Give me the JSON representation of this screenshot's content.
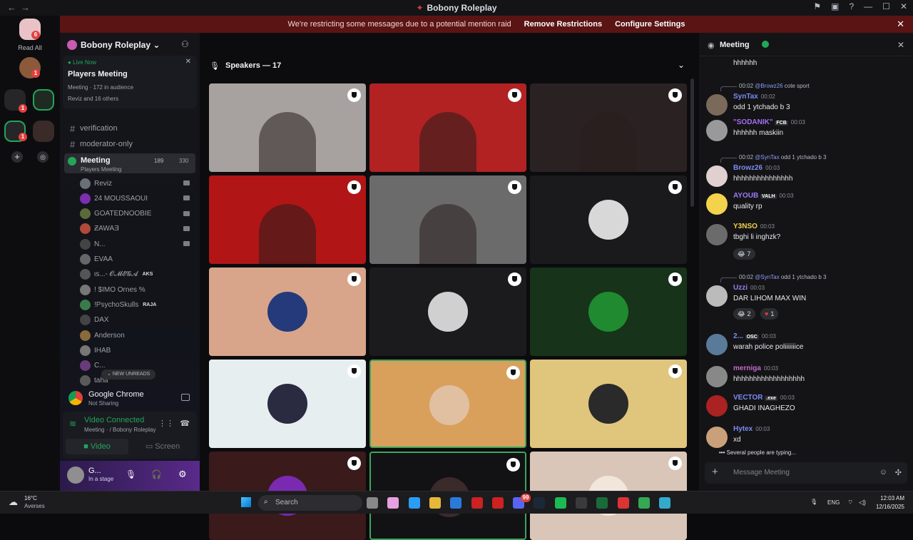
{
  "window": {
    "title": "Bobony Roleplay"
  },
  "banner": {
    "message": "We're restricting some messages due to a potential mention raid",
    "remove": "Remove Restrictions",
    "configure": "Configure Settings"
  },
  "rail": {
    "read_all": "Read All",
    "badges": [
      "6",
      "1",
      "1",
      "1",
      "1"
    ]
  },
  "sidebar": {
    "server_name": "Bobony Roleplay",
    "live": {
      "label": "Live Now",
      "title": "Players Meeting",
      "meta_channel": "Meeting",
      "audience": "172 in audience",
      "others": "Reviz and 16 others"
    },
    "channels": [
      {
        "name": "verification"
      },
      {
        "name": "moderator-only"
      }
    ],
    "active_channel": {
      "name": "Meeting",
      "sub": "Players Meeting",
      "count_a": "189",
      "count_b": "330"
    },
    "users": [
      {
        "name": "Reviz",
        "tag": ""
      },
      {
        "name": "24 MOUSSAOUI",
        "tag": ""
      },
      {
        "name": "GOATEDNOOBIE",
        "tag": ""
      },
      {
        "name": "ƵAWAƎ",
        "tag": ""
      },
      {
        "name": "N...",
        "tag": ""
      },
      {
        "name": "EVAA",
        "tag": ""
      },
      {
        "name": "ιѕ...- 𝓞𝓜𝓔𝓖𝓐",
        "tag": "AKS"
      },
      {
        "name": "! $IMO Ornes %",
        "tag": ""
      },
      {
        "name": "!PsychoSkulls",
        "tag": "RAJA"
      },
      {
        "name": "DAX",
        "tag": ""
      },
      {
        "name": "Anderson",
        "tag": ""
      },
      {
        "name": "IHAB",
        "tag": ""
      },
      {
        "name": "C...",
        "tag": ""
      },
      {
        "name": "taha",
        "tag": ""
      }
    ],
    "new_unreads": "NEW UNREADS",
    "activity": {
      "app": "Google Chrome",
      "status": "Not Sharing"
    },
    "voice": {
      "status": "Video Connected",
      "detail": "Meeting",
      "server": "/ Bobony Roleplay",
      "video_btn": "Video",
      "screen_btn": "Screen"
    },
    "account": {
      "name": "G...",
      "status": "In a stage"
    }
  },
  "stage": {
    "header": "Speakers — 17"
  },
  "chat": {
    "title": "Meeting",
    "messages": [
      {
        "name": "",
        "time": "",
        "text": "hhhhhh",
        "color": "#e8e9eb"
      },
      {
        "reply_time": "00:02",
        "reply_user": "@Browz26",
        "reply_text": "cote sport",
        "name": "SynTax",
        "time": "00:02",
        "text": "odd 1 ytchado b 3",
        "color": "#7b8cf0"
      },
      {
        "name": "\"SODANIK\"",
        "tag": "FCB",
        "time": "00:03",
        "text": "hhhhhh maskiin",
        "color": "#a66cf5"
      },
      {
        "reply_time": "00:02",
        "reply_user": "@SynTax",
        "reply_text": "odd 1 ytchado b 3",
        "name": "Browz26",
        "time": "00:03",
        "text": "hhhhhhhhhhhhhhh",
        "color": "#7b8cf0"
      },
      {
        "name": "AYOUB",
        "tag": "VALH",
        "time": "00:03",
        "text": "quality rp",
        "color": "#9a7cf2"
      },
      {
        "name": "Y3NSO",
        "time": "00:03",
        "text": "tbghi li inghzk?",
        "color": "#f2d34b"
      },
      {
        "reply_time": "00:02",
        "reply_user": "@SynTax",
        "reply_text": "odd 1 ytchado b 3",
        "name": "Uzzi",
        "time": "00:03",
        "text": "DAR LIHOM MAX WIN",
        "color": "#9a7cf2"
      },
      {
        "name": "2...",
        "tag": "OSC",
        "time": "00:03",
        "text": "warah police poliiiiiiice",
        "color": "#7b8cf0"
      },
      {
        "name": "merniga",
        "time": "00:03",
        "text": "hhhhhhhhhhhhhhhhhh",
        "color": "#c46ac9"
      },
      {
        "name": "VECTOR",
        "tag": ".exe",
        "time": "00:03",
        "text": "GHADI INAGHEZO",
        "color": "#7b8cf0"
      },
      {
        "name": "Hytex",
        "time": "00:03",
        "text": "xd",
        "color": "#7b8cf0"
      }
    ],
    "reactions": {
      "y3nso_laugh": "7",
      "uzzi_laugh": "2",
      "uzzi_heart": "1"
    },
    "typing": "Several people are typing...",
    "input_placeholder": "Message Meeting"
  },
  "taskbar": {
    "weather": {
      "temp": "16°C",
      "cond": "Averses"
    },
    "search": "Search",
    "lang": "ENG",
    "time": "12:03 AM",
    "date": "12/16/2025",
    "discord_badge": "99"
  },
  "colors": {
    "accent": "#5865f2",
    "green": "#23a55a",
    "red_banner": "#5a1414",
    "speaking": "#3ba55d"
  }
}
